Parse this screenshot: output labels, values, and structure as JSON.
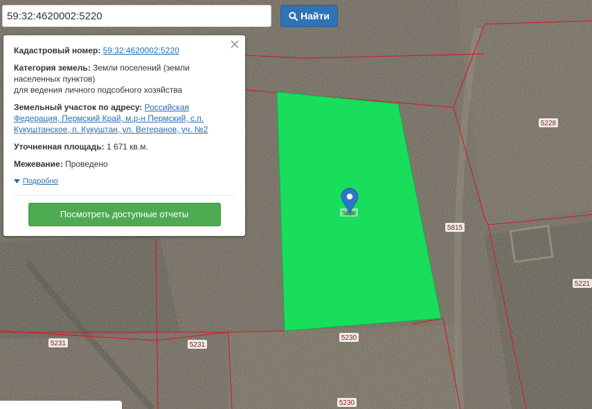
{
  "search": {
    "value": "59:32:4620002:5220",
    "button_label": "Найти"
  },
  "popup": {
    "cadastral_label": "Кадастровый номер:",
    "cadastral_value": "59:32:4620002:5220",
    "category_label": "Категория земель:",
    "category_value": "Земли поселений (земли населенных пунктов)",
    "category_purpose": "для ведения личного подсобного хозяйства",
    "address_label": "Земельный участок по адресу:",
    "address_value": "Российская Федерация, Пермский Край, м.р-н Пермский, с.п. Кукуштанское, п. Кукуштан, ул. Ветеранов, уч. №2",
    "area_label": "Уточненная площадь:",
    "area_value": "1 671 кв.м.",
    "survey_label": "Межевание:",
    "survey_value": "Проведено",
    "details_link": "Подробно",
    "reports_button": "Посмотреть доступные отчеты"
  },
  "map": {
    "parcel_labels": [
      "5228",
      "5815",
      "5221",
      "5231",
      "5231",
      "5230",
      "5230",
      "5220"
    ],
    "colors": {
      "selected_parcel": "#13e45c",
      "boundary": "#c8242c",
      "label_text": "#8a1a1a",
      "marker": "#2c78c6"
    }
  }
}
